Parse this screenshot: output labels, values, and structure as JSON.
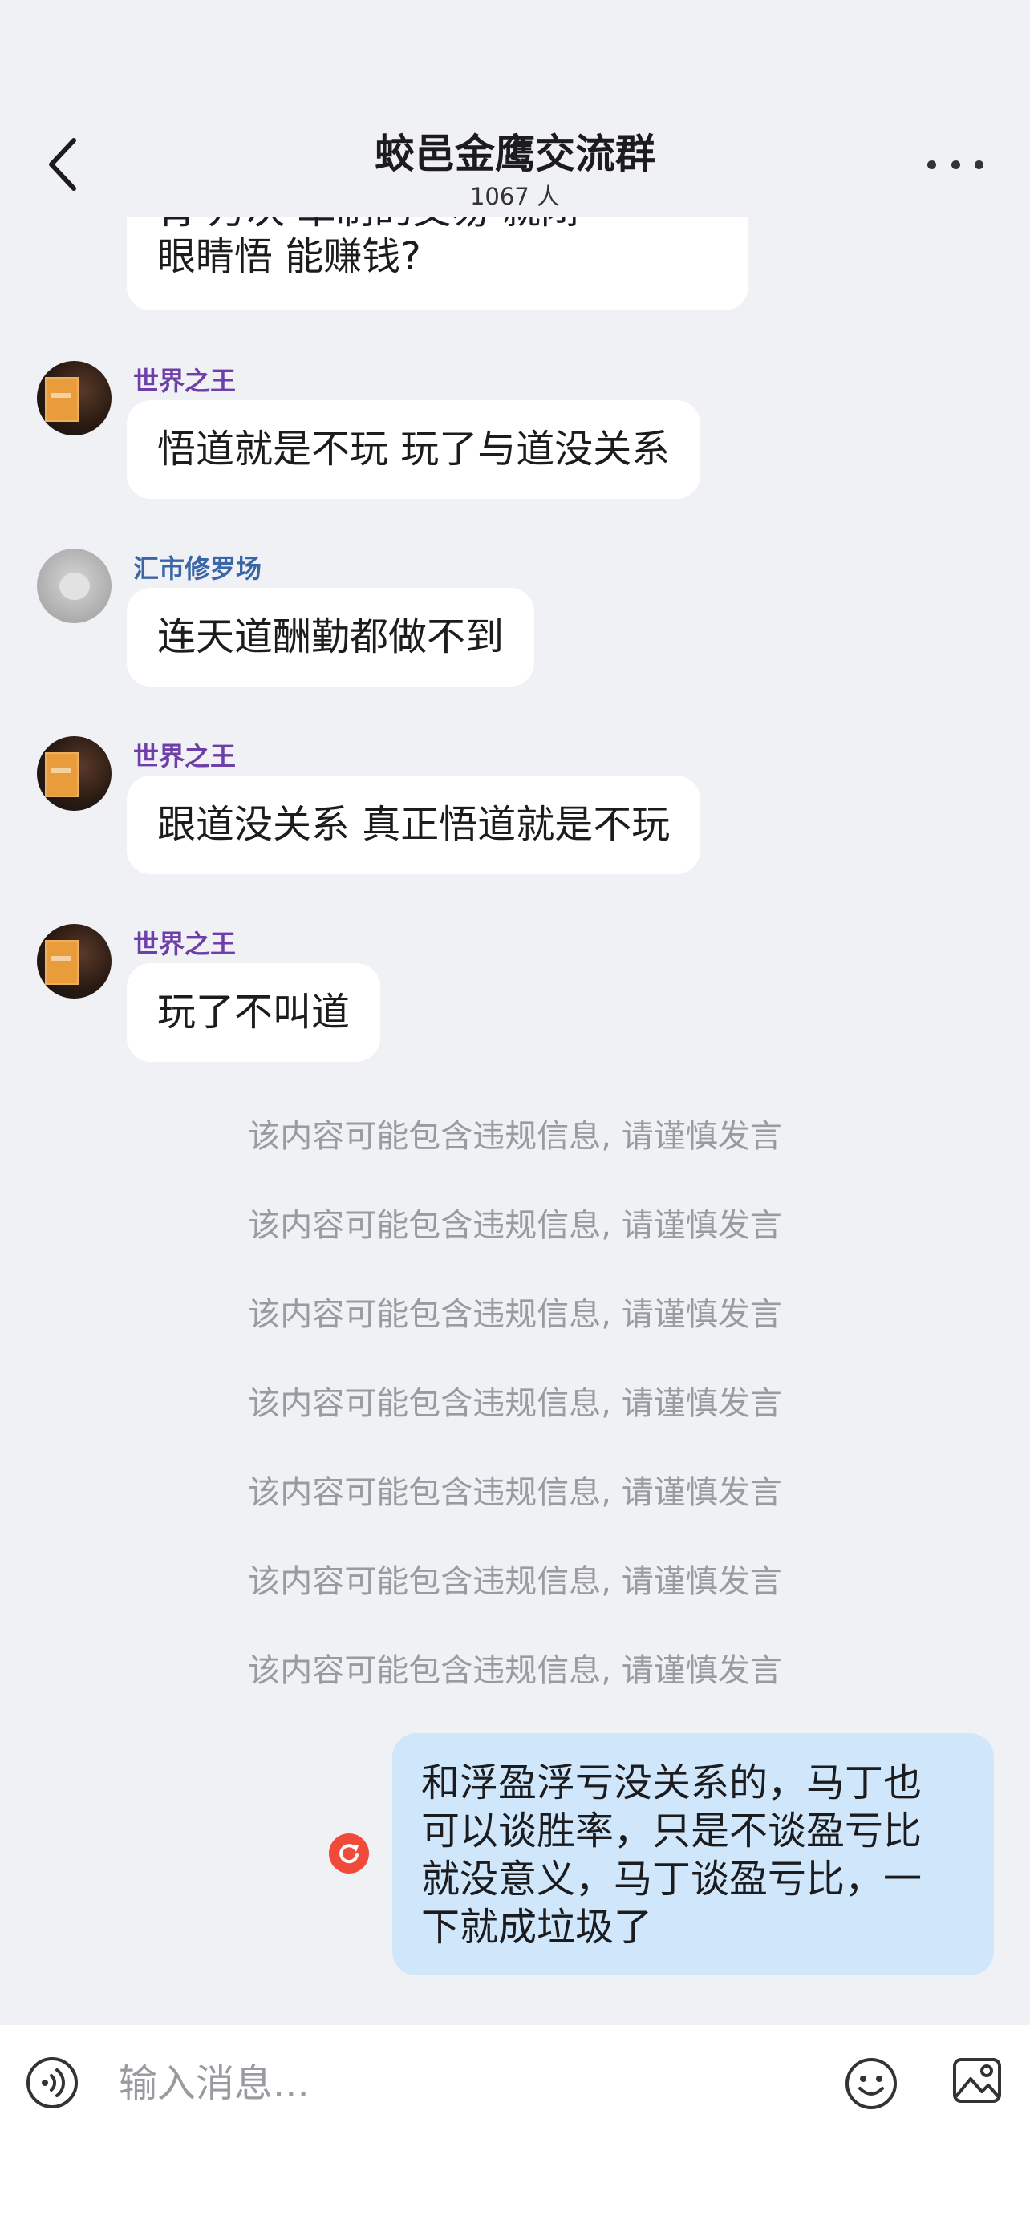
{
  "header": {
    "title": "蛟邑金鹰交流群",
    "member_count": "1067 人",
    "icons": {
      "back": "chevron-left-icon",
      "more": "more-dots-icon"
    }
  },
  "messages": {
    "partial_top_line": "肯 万次 革制的交易 就闭",
    "partial_text": "眼睛悟 能赚钱?",
    "items": [
      {
        "sender": "世界之王",
        "text": "悟道就是不玩 玩了与道没关系"
      },
      {
        "sender": "汇市修罗场",
        "text": "连天道酬勤都做不到"
      },
      {
        "sender": "世界之王",
        "text": "跟道没关系 真正悟道就是不玩"
      },
      {
        "sender": "世界之王",
        "text": "玩了不叫道"
      }
    ],
    "notices": [
      "该内容可能包含违规信息, 请谨慎发言",
      "该内容可能包含违规信息, 请谨慎发言",
      "该内容可能包含违规信息, 请谨慎发言",
      "该内容可能包含违规信息, 请谨慎发言",
      "该内容可能包含违规信息, 请谨慎发言",
      "该内容可能包含违规信息, 请谨慎发言",
      "该内容可能包含违规信息, 请谨慎发言"
    ],
    "self_text": "和浮盈浮亏没关系的，马丁也\n可以谈胜率，只是不谈盈亏比\n就没意义，马丁谈盈亏比，一\n下就成垃圾了"
  },
  "input_bar": {
    "placeholder": "输入消息...",
    "value": "",
    "icons": {
      "voice": "voice-icon",
      "emoji": "emoji-icon",
      "image": "image-icon"
    }
  },
  "colors": {
    "background": "#f0f1f5",
    "bubble_self": "#cfe6fb",
    "sender_purple": "#6e3fa8",
    "sender_blue": "#3a66a8",
    "retry_red": "#f04a3a",
    "notice_gray": "#9a9ba0"
  }
}
